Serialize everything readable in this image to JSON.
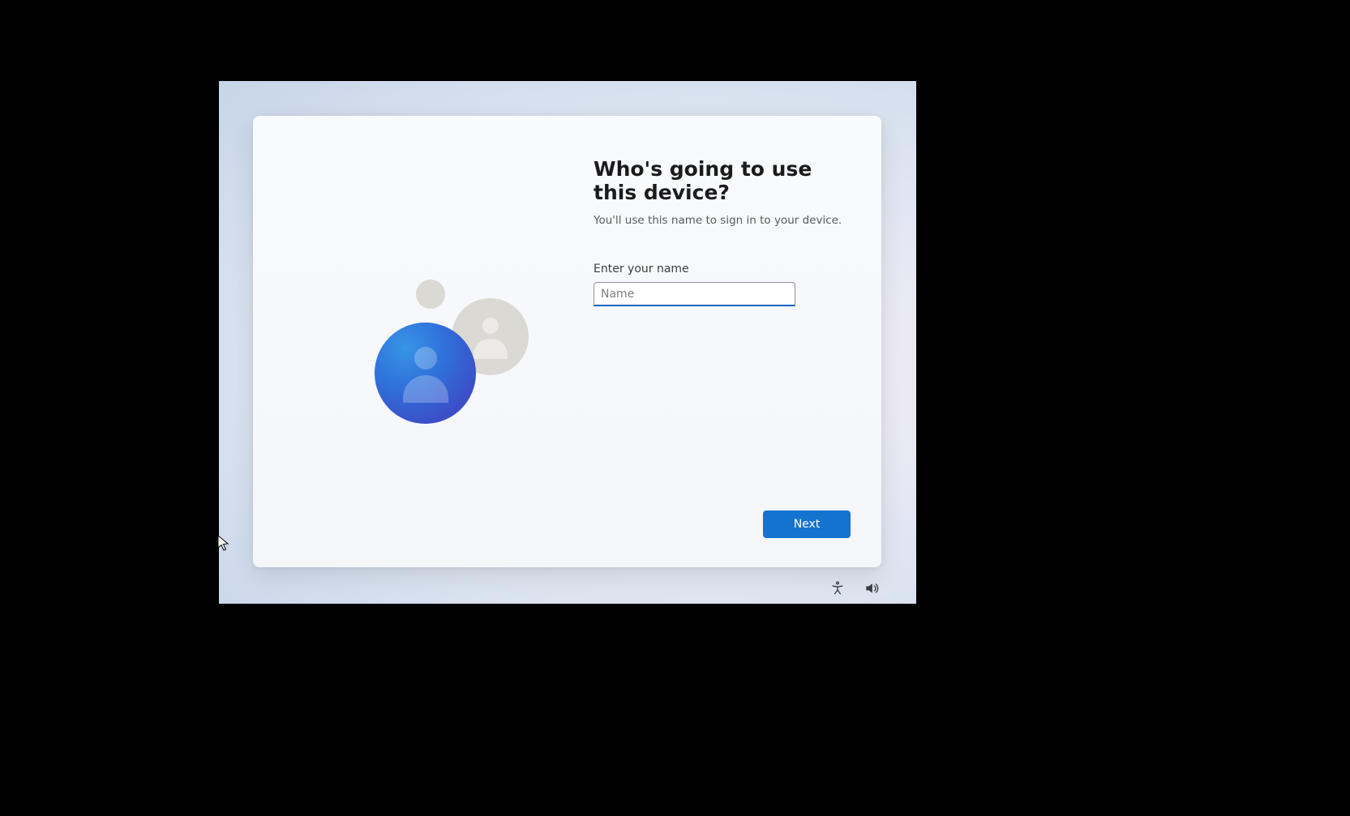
{
  "heading": "Who's going to use this device?",
  "subtext": "You'll use this name to sign in to your device.",
  "input_label": "Enter your name",
  "input_placeholder": "Name",
  "input_value": "",
  "next_button_label": "Next",
  "colors": {
    "accent": "#1373d0",
    "input_focus": "#0067c0"
  },
  "icons": {
    "accessibility": "accessibility-icon",
    "volume": "volume-icon"
  }
}
